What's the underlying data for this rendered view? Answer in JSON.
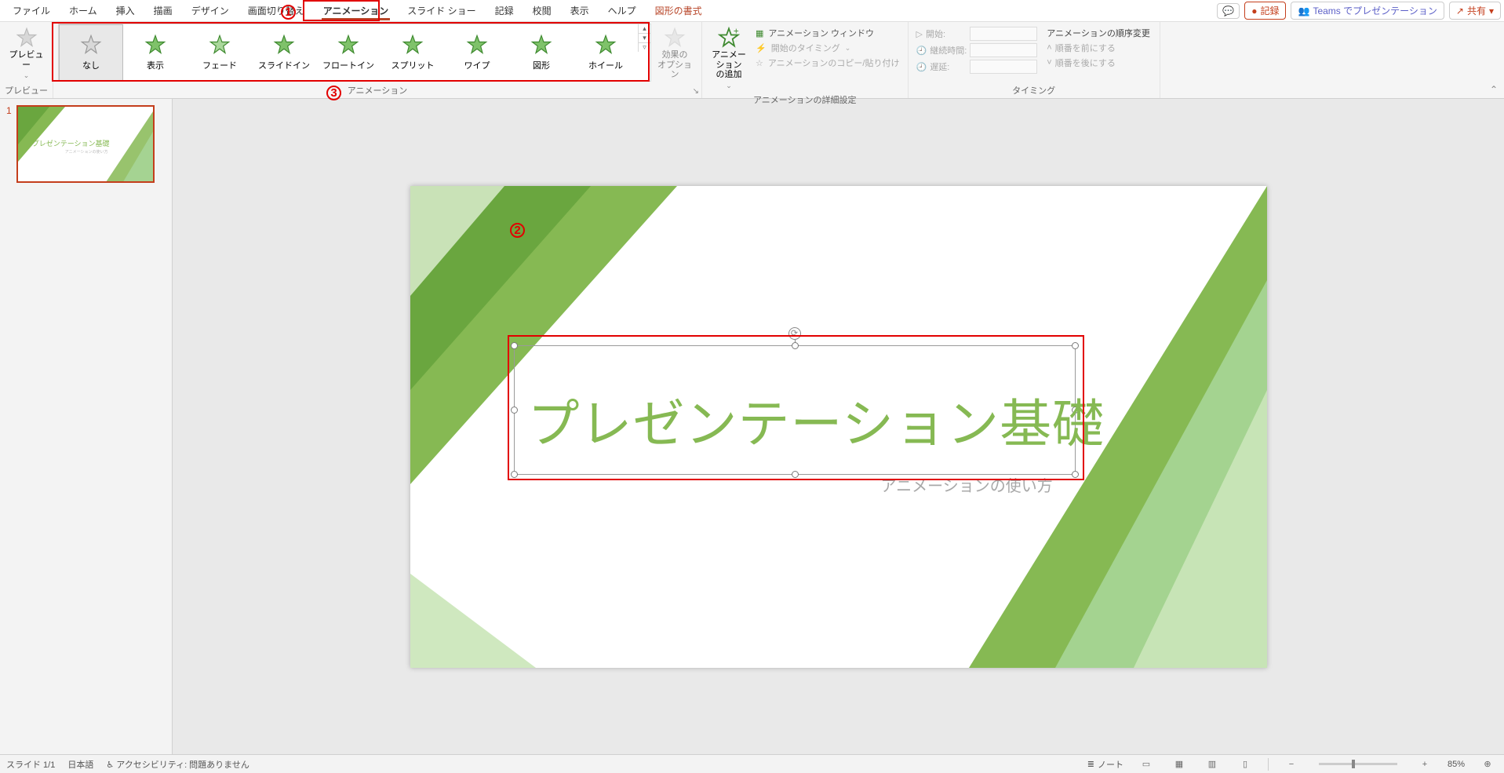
{
  "menu": {
    "tabs": [
      "ファイル",
      "ホーム",
      "挿入",
      "描画",
      "デザイン",
      "画面切り替え",
      "アニメーション",
      "スライド ショー",
      "記録",
      "校閲",
      "表示",
      "ヘルプ",
      "図形の書式"
    ],
    "activeIndex": 6,
    "contextIndex": 12,
    "comment_tip": "コメント",
    "record": "記録",
    "teams": "Teams でプレゼンテーション",
    "share": "共有"
  },
  "annotations": {
    "one": "1",
    "two": "2",
    "three": "3"
  },
  "ribbon": {
    "preview": {
      "label": "プレビュー",
      "group": "プレビュー"
    },
    "gallery": {
      "items": [
        "なし",
        "表示",
        "フェード",
        "スライドイン",
        "フロートイン",
        "スプリット",
        "ワイプ",
        "図形",
        "ホイール"
      ],
      "group": "アニメーション"
    },
    "effect_options": "効果の\nオプション",
    "add_animation": "アニメーション\nの追加",
    "adv": {
      "pane": "アニメーション ウィンドウ",
      "trigger": "開始のタイミング",
      "painter": "アニメーションのコピー/貼り付け",
      "group": "アニメーションの詳細設定"
    },
    "timing": {
      "start": "開始:",
      "duration": "継続時間:",
      "delay": "遅延:",
      "group": "タイミング"
    },
    "reorder": {
      "header": "アニメーションの順序変更",
      "earlier": "順番を前にする",
      "later": "順番を後にする"
    }
  },
  "thumb": {
    "num": "1",
    "title": "プレゼンテーション基礎",
    "sub": "アニメーションの使い方"
  },
  "slide": {
    "title": "プレゼンテーション基礎",
    "subtitle": "アニメーションの使い方"
  },
  "status": {
    "slide": "スライド 1/1",
    "lang": "日本語",
    "a11y": "アクセシビリティ: 問題ありません",
    "notes": "ノート",
    "zoom": "85%"
  }
}
